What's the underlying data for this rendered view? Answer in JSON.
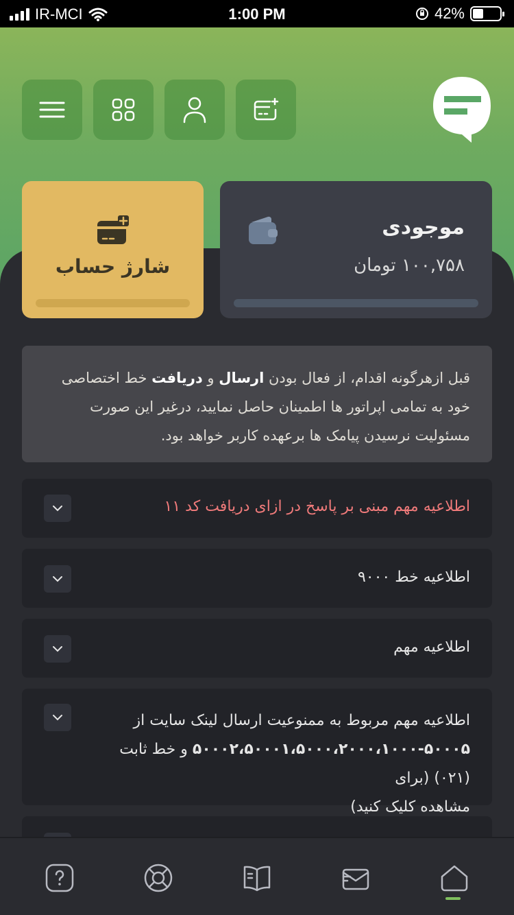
{
  "status_bar": {
    "carrier": "IR-MCI",
    "time": "1:00 PM",
    "battery": "42%"
  },
  "header": {
    "buttons": [
      "menu-icon",
      "grid-icon",
      "user-icon",
      "card-add-icon"
    ],
    "brand_color": "#5aa766"
  },
  "balance_card": {
    "title": "موجودی",
    "amount": "۱۰۰,۷۵۸ تومان"
  },
  "charge_card": {
    "title": "شارژ حساب"
  },
  "notice": {
    "text_before": "قبل ازهرگونه اقدام، از فعال بودن ",
    "bold1": "ارسال",
    "text_mid": " و ",
    "bold2": "دریافت",
    "text_after": " خط اختصاصی خود به تمامی اپراتور ها اطمینان حاصل نمایید، درغیر این صورت مسئولیت نرسیدن پیامک ها برعهده کاربر خواهد بود."
  },
  "announcements": [
    {
      "title": "اطلاعیه مهم مبنی بر پاسخ در ازای دریافت کد ۱۱",
      "color": "#ef7a7a"
    },
    {
      "title": "اطلاعیه خط ۹۰۰۰"
    },
    {
      "title": "اطلاعیه مهم"
    },
    {
      "title_line1": "اطلاعیه مهم مربوط به ممنوعیت ارسال لینک سایت از",
      "title_line2_bold": "۵۰۰۰۲،۵۰۰۰۱،۵۰۰۰،۲۰۰۰،۱۰۰۰-۵۰۰۰۵",
      "title_line2_rest": " و خط ثابت (۰۲۱) (برای",
      "title_line3": "مشاهده کلیک کنید)"
    }
  ],
  "bottom_nav": [
    "help-icon",
    "support-icon",
    "guide-icon",
    "messages-icon",
    "home-icon"
  ]
}
